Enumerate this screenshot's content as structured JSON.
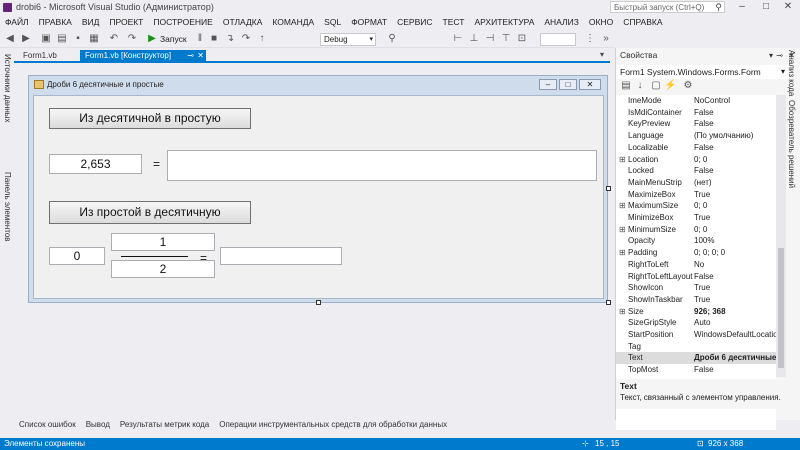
{
  "window": {
    "title": "drobi6 - Microsoft Visual Studio (Администратор)",
    "quick_launch": "Быстрый запуск (Ctrl+Q)"
  },
  "menu": [
    "ФАЙЛ",
    "ПРАВКА",
    "ВИД",
    "ПРОЕКТ",
    "ПОСТРОЕНИЕ",
    "ОТЛАДКА",
    "КОМАНДА",
    "SQL",
    "ФОРМАТ",
    "СЕРВИС",
    "ТЕСТ",
    "АРХИТЕКТУРА",
    "АНАЛИЗ",
    "ОКНО",
    "СПРАВКА"
  ],
  "toolbar": {
    "run_label": "Запуск",
    "config": "Debug"
  },
  "left_strip": {
    "data_sources": "Источники данных",
    "toolbox": "Панель элементов"
  },
  "tabs": {
    "form_code": "Form1.vb",
    "form_designer": "Form1.vb [Конструктор]"
  },
  "form": {
    "title": "Дроби 6 десятичные и простые",
    "button1": "Из десятичной в простую",
    "decimal_value": "2,653",
    "equals1": "=",
    "button2": "Из простой в десятичную",
    "whole_part": "0",
    "numerator": "1",
    "denominator": "2",
    "equals2": "="
  },
  "properties": {
    "header": "Свойства",
    "object": "Form1  System.Windows.Forms.Form",
    "rows": [
      {
        "name": "ImeMode",
        "value": "NoControl",
        "exp": ""
      },
      {
        "name": "IsMdiContainer",
        "value": "False",
        "exp": ""
      },
      {
        "name": "KeyPreview",
        "value": "False",
        "exp": ""
      },
      {
        "name": "Language",
        "value": "(По умолчанию)",
        "exp": ""
      },
      {
        "name": "Localizable",
        "value": "False",
        "exp": ""
      },
      {
        "name": "Location",
        "value": "0; 0",
        "exp": "⊞"
      },
      {
        "name": "Locked",
        "value": "False",
        "exp": ""
      },
      {
        "name": "MainMenuStrip",
        "value": "(нет)",
        "exp": ""
      },
      {
        "name": "MaximizeBox",
        "value": "True",
        "exp": ""
      },
      {
        "name": "MaximumSize",
        "value": "0; 0",
        "exp": "⊞"
      },
      {
        "name": "MinimizeBox",
        "value": "True",
        "exp": ""
      },
      {
        "name": "MinimumSize",
        "value": "0; 0",
        "exp": "⊞"
      },
      {
        "name": "Opacity",
        "value": "100%",
        "exp": ""
      },
      {
        "name": "Padding",
        "value": "0; 0; 0; 0",
        "exp": "⊞"
      },
      {
        "name": "RightToLeft",
        "value": "No",
        "exp": ""
      },
      {
        "name": "RightToLeftLayout",
        "value": "False",
        "exp": ""
      },
      {
        "name": "ShowIcon",
        "value": "True",
        "exp": ""
      },
      {
        "name": "ShowInTaskbar",
        "value": "True",
        "exp": ""
      },
      {
        "name": "Size",
        "value": "926; 368",
        "exp": "⊞",
        "bold": true
      },
      {
        "name": "SizeGripStyle",
        "value": "Auto",
        "exp": ""
      },
      {
        "name": "StartPosition",
        "value": "WindowsDefaultLocation",
        "exp": ""
      },
      {
        "name": "Tag",
        "value": "",
        "exp": ""
      },
      {
        "name": "Text",
        "value": "Дроби 6 десятичные",
        "exp": "",
        "bold": true,
        "selected": true
      },
      {
        "name": "TopMost",
        "value": "False",
        "exp": ""
      }
    ],
    "desc_title": "Text",
    "desc_text": "Текст, связанный с элементом управления."
  },
  "right_strip": {
    "code_analysis": "Анализ кода",
    "solution_explorer": "Обозреватель решений"
  },
  "bottom_tabs": [
    "Список ошибок",
    "Вывод",
    "Результаты метрик кода",
    "Операции инструментальных средств для обработки данных"
  ],
  "status": {
    "message": "Элементы сохранены",
    "position": "15 , 15",
    "size": "926 x 368"
  }
}
